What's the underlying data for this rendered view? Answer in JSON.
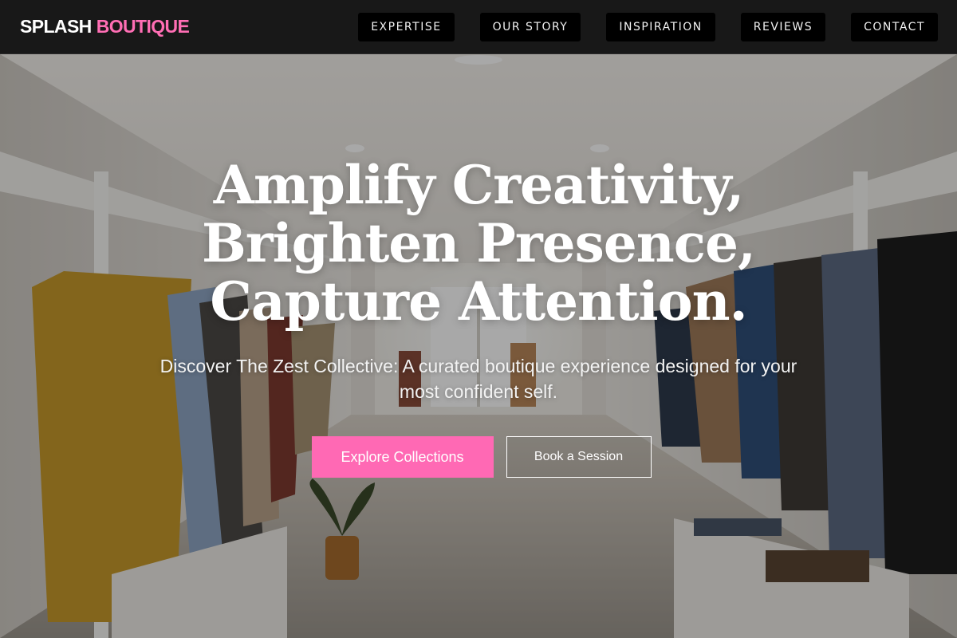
{
  "brand": {
    "name_first": "SPLASH",
    "name_second": "BOUTIQUE",
    "accent_color": "#ff6eb4"
  },
  "nav": {
    "items": [
      {
        "label": "EXPERTISE"
      },
      {
        "label": "OUR STORY"
      },
      {
        "label": "INSPIRATION"
      },
      {
        "label": "REVIEWS"
      },
      {
        "label": "CONTACT"
      }
    ]
  },
  "hero": {
    "title_lines": [
      "Amplify Creativity,",
      "Brighten Presence,",
      "Capture Attention."
    ],
    "subtitle": "Discover The Zest Collective: A curated boutique experience designed for your most confident self.",
    "primary_button": "Explore Collections",
    "secondary_button": "Book a Session",
    "primary_color": "#ff69b4"
  }
}
